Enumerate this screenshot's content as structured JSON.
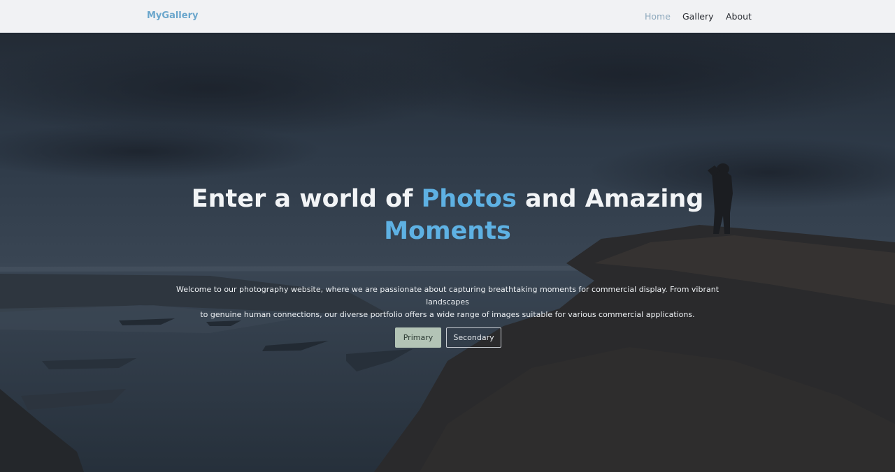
{
  "navbar": {
    "brand": "MyGallery",
    "links": [
      {
        "label": "Home",
        "active": true
      },
      {
        "label": "Gallery",
        "active": false
      },
      {
        "label": "About",
        "active": false
      }
    ]
  },
  "hero": {
    "headline_part1": "Enter a world of ",
    "headline_accent1": "Photos",
    "headline_part2": " and Amazing ",
    "headline_accent2": "Moments",
    "lead_line1": "Welcome to our photography website, where we are passionate about capturing breathtaking moments for commercial display. From vibrant landscapes",
    "lead_line2": "to genuine human connections, our diverse portfolio offers a wide range of images suitable for various commercial applications.",
    "primary_button": "Primary",
    "secondary_button": "Secondary"
  },
  "colors": {
    "accent": "#5eb1e3",
    "brand": "#6aa6cc",
    "primary_button_bg": "#b3c4b6",
    "navbar_bg": "#f1f2f4"
  }
}
